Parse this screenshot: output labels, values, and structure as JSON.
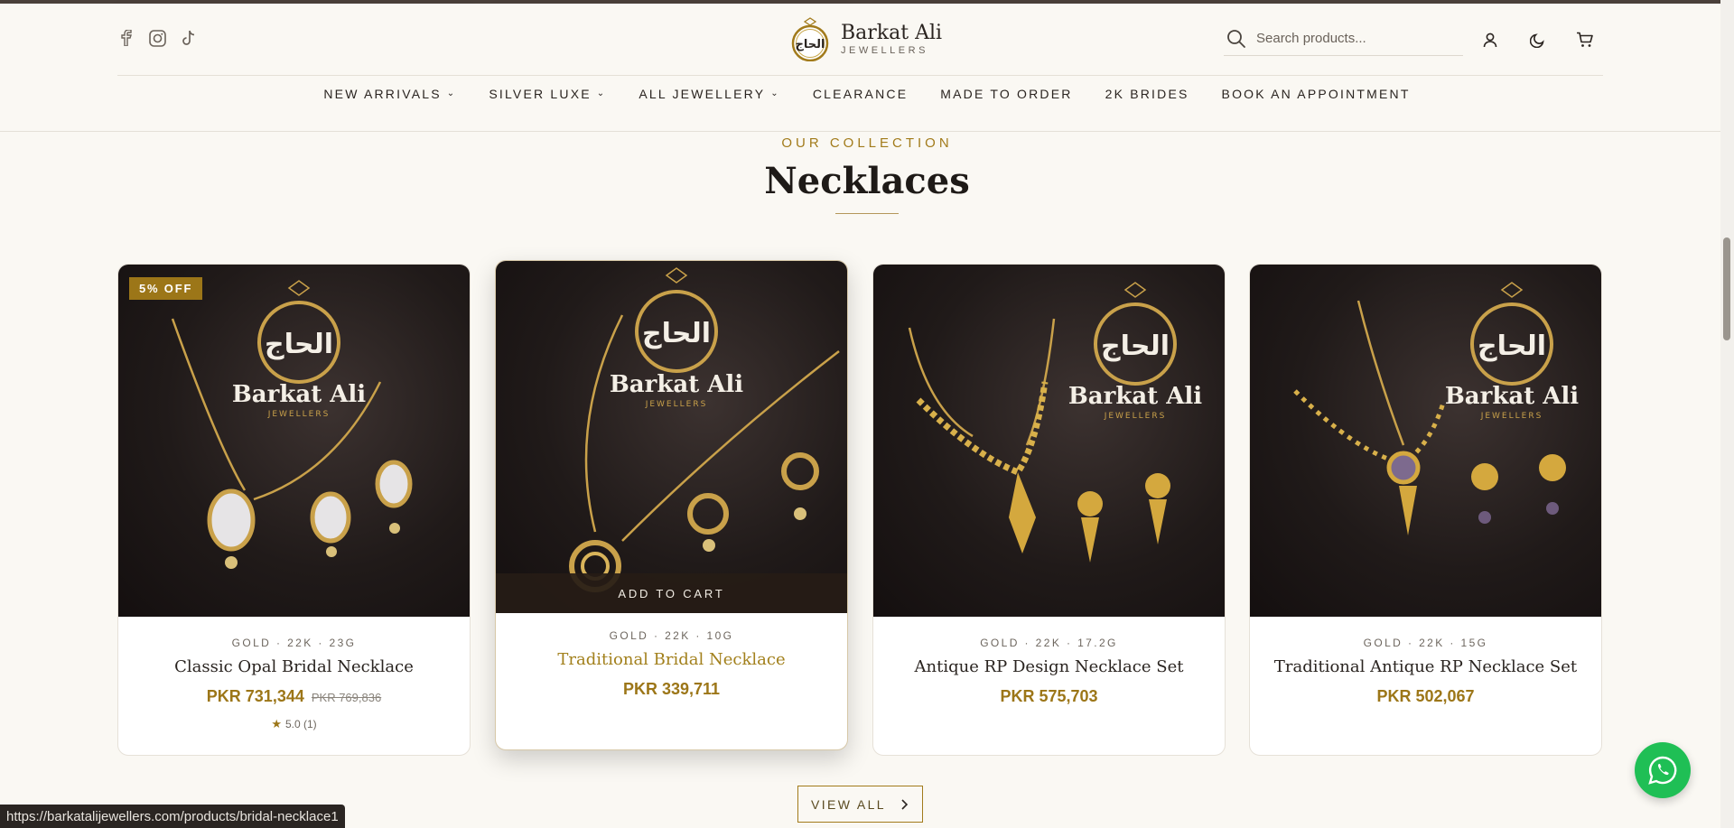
{
  "brand": {
    "name": "Barkat Ali",
    "subtitle": "JEWELLERS"
  },
  "search": {
    "placeholder": "Search products..."
  },
  "nav": [
    {
      "label": "NEW ARRIVALS",
      "has_dropdown": true
    },
    {
      "label": "SILVER LUXE",
      "has_dropdown": true
    },
    {
      "label": "ALL JEWELLERY",
      "has_dropdown": true
    },
    {
      "label": "CLEARANCE",
      "has_dropdown": false
    },
    {
      "label": "MADE TO ORDER",
      "has_dropdown": false
    },
    {
      "label": "2K BRIDES",
      "has_dropdown": false
    },
    {
      "label": "BOOK AN APPOINTMENT",
      "has_dropdown": false
    }
  ],
  "section": {
    "eyebrow": "OUR COLLECTION",
    "title": "Necklaces"
  },
  "products": [
    {
      "badge": "5% OFF",
      "meta": "GOLD · 22K · 23G",
      "name": "Classic Opal Bridal Necklace",
      "price": "PKR 731,344",
      "old_price": "PKR 769,836",
      "rating": "5.0 (1)"
    },
    {
      "meta": "GOLD · 22K · 10G",
      "name": "Traditional Bridal Necklace",
      "price": "PKR 339,711",
      "add_to_cart": "ADD TO CART"
    },
    {
      "meta": "GOLD · 22K · 17.2G",
      "name": "Antique RP Design Necklace Set",
      "price": "PKR 575,703"
    },
    {
      "meta": "GOLD · 22K · 15G",
      "name": "Traditional Antique RP Necklace Set",
      "price": "PKR 502,067"
    }
  ],
  "image_overlay": {
    "arabic": "الحاج",
    "brand": "Barkat Ali",
    "sub": "JEWELLERS"
  },
  "view_all": "VIEW ALL",
  "status_url": "https://barkatalijewellers.com/products/bridal-necklace1",
  "colors": {
    "gold": "#9c7618",
    "background": "#faf8f3",
    "whatsapp": "#1fbf55"
  },
  "icons": [
    "facebook-icon",
    "instagram-icon",
    "tiktok-icon",
    "search-icon",
    "user-icon",
    "moon-icon",
    "cart-icon",
    "chevron-right-icon",
    "whatsapp-icon",
    "star-icon"
  ]
}
